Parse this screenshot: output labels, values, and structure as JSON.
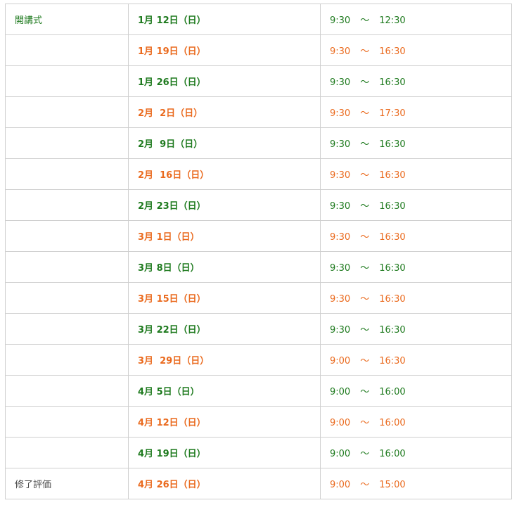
{
  "colors": {
    "green": "#1e7a1e",
    "orange": "#ea6a1e",
    "border": "#cfcfcf",
    "label_gray": "#444444"
  },
  "rows": [
    {
      "label": "開講式",
      "date": "1月 12日（日）",
      "start": "9:30",
      "sep": "～",
      "end": "12:30",
      "color": "green"
    },
    {
      "label": "",
      "date": "1月 19日（日）",
      "start": "9:30",
      "sep": "～",
      "end": "16:30",
      "color": "orange"
    },
    {
      "label": "",
      "date": "1月 26日（日）",
      "start": "9:30",
      "sep": "～",
      "end": "16:30",
      "color": "green"
    },
    {
      "label": "",
      "date": "2月  2日（日）",
      "start": "9:30",
      "sep": "～",
      "end": "17:30",
      "color": "orange"
    },
    {
      "label": "",
      "date": "2月  9日（日）",
      "start": "9:30",
      "sep": "～",
      "end": "16:30",
      "color": "green"
    },
    {
      "label": "",
      "date": "2月  16日（日）",
      "start": "9:30",
      "sep": "～",
      "end": "16:30",
      "color": "orange"
    },
    {
      "label": "",
      "date": "2月 23日（日）",
      "start": "9:30",
      "sep": "～",
      "end": "16:30",
      "color": "green"
    },
    {
      "label": "",
      "date": "3月 1日（日）",
      "start": "9:30",
      "sep": "～",
      "end": "16:30",
      "color": "orange"
    },
    {
      "label": "",
      "date": "3月 8日（日）",
      "start": "9:30",
      "sep": "～",
      "end": "16:30",
      "color": "green"
    },
    {
      "label": "",
      "date": "3月 15日（日）",
      "start": "9:30",
      "sep": "～",
      "end": "16:30",
      "color": "orange"
    },
    {
      "label": "",
      "date": "3月 22日（日）",
      "start": "9:30",
      "sep": "～",
      "end": "16:30",
      "color": "green"
    },
    {
      "label": "",
      "date": "3月  29日（日）",
      "start": "9:00",
      "sep": "～",
      "end": "16:30",
      "color": "orange"
    },
    {
      "label": "",
      "date": "4月 5日（日）",
      "start": "9:00",
      "sep": "～",
      "end": "16:00",
      "color": "green"
    },
    {
      "label": "",
      "date": "4月 12日（日）",
      "start": "9:00",
      "sep": "～",
      "end": "16:00",
      "color": "orange"
    },
    {
      "label": "",
      "date": "4月 19日（日）",
      "start": "9:00",
      "sep": "～",
      "end": "16:00",
      "color": "green"
    },
    {
      "label": "修了評価",
      "date": "4月 26日（日）",
      "start": "9:00",
      "sep": "～",
      "end": "15:00",
      "color": "orange"
    }
  ]
}
